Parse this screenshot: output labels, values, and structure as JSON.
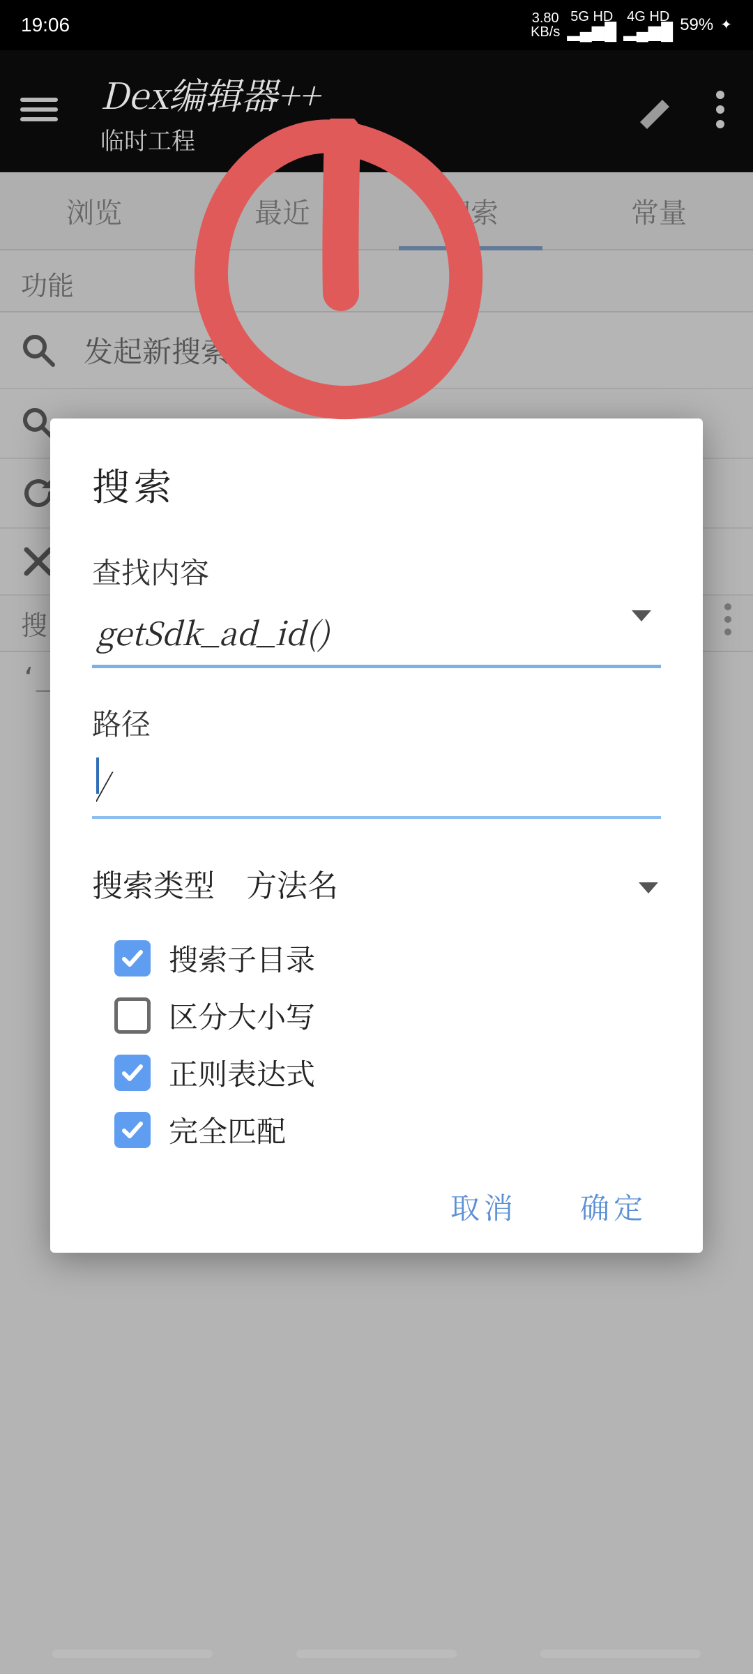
{
  "status": {
    "time": "19:06",
    "net_speed_top": "3.80",
    "net_speed_unit": "KB/s",
    "sig1_top": "5G HD",
    "sig2_top": "4G HD",
    "battery_pct": "59%"
  },
  "appbar": {
    "title": "Dex编辑器++",
    "subtitle": "临时工程"
  },
  "tabs": [
    "浏览",
    "最近",
    "搜索",
    "常量"
  ],
  "active_tab_index": 2,
  "section_label": "功能",
  "rows": {
    "r0": "发起新搜索"
  },
  "listbar_label": "搜",
  "snippet": "‘_",
  "dialog": {
    "title": "搜索",
    "find_label": "查找内容",
    "find_value": "getSdk_ad_id()",
    "path_label": "路径",
    "path_value": "/",
    "type_label": "搜索类型",
    "type_value": "方法名",
    "checks": {
      "subdir": {
        "label": "搜索子目录",
        "checked": true
      },
      "case": {
        "label": "区分大小写",
        "checked": false
      },
      "regex": {
        "label": "正则表达式",
        "checked": true
      },
      "exact": {
        "label": "完全匹配",
        "checked": true
      }
    },
    "cancel": "取消",
    "ok": "确定"
  }
}
